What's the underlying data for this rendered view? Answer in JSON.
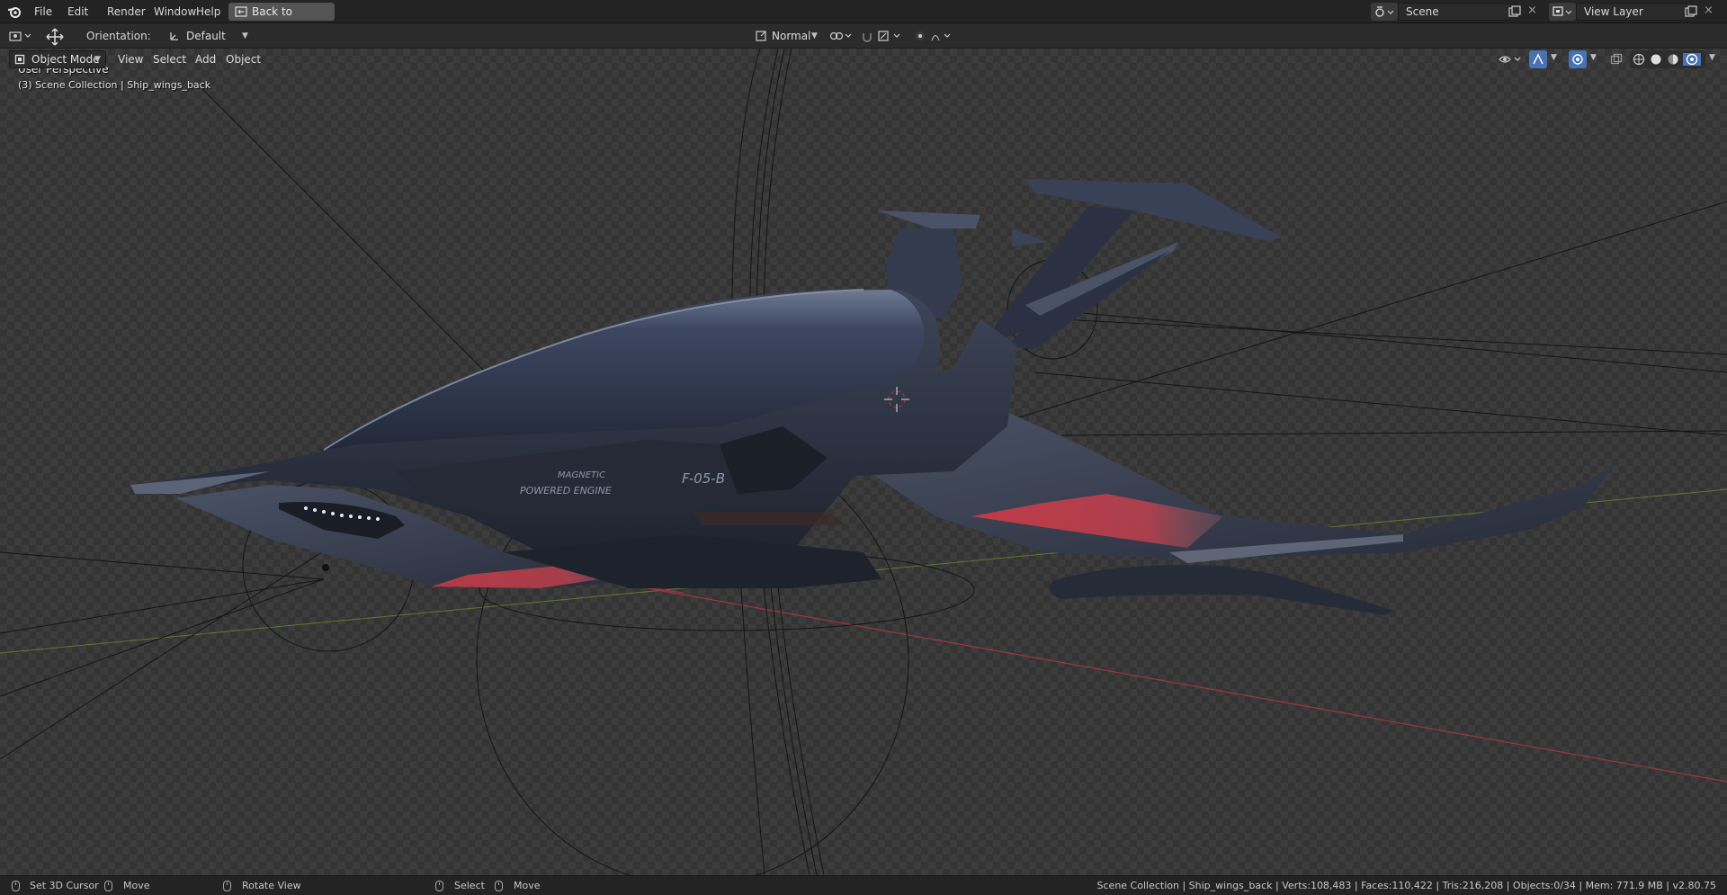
{
  "menu": {
    "items": [
      "File",
      "Edit",
      "Render",
      "Window",
      "Help"
    ],
    "back_button": "Back to Previous",
    "scene_name": "Scene",
    "view_layer_name": "View Layer"
  },
  "tool_settings": {
    "orientation_label": "Orientation:",
    "orientation_value": "Default",
    "pivot_value": "Normal"
  },
  "viewport_header": {
    "mode": "Object Mode",
    "menus": [
      "View",
      "Select",
      "Add",
      "Object"
    ]
  },
  "viewport": {
    "perspective": "User Perspective",
    "collection_info": "(3) Scene Collection | Ship_wings_back",
    "decals": [
      "MAGNETIC",
      "POWERED ENGINE",
      "F-05-B"
    ]
  },
  "status": {
    "set_cursor": "Set 3D Cursor",
    "move1": "Move",
    "rotate_view": "Rotate View",
    "select": "Select",
    "move2": "Move",
    "stats": "Scene Collection | Ship_wings_back | Verts:108,483 | Faces:110,422 | Tris:216,208 | Objects:0/34 | Mem: 771.9 MB | v2.80.75"
  },
  "colors": {
    "accent_blue": "#4772b3",
    "ship_body": "#2e3445",
    "ship_red": "#c83a46",
    "x_axis": "#a03540",
    "y_axis": "#6a8a2a"
  },
  "icons": [
    "blender-logo",
    "back-icon",
    "scene-icon",
    "view-layer-icon",
    "transform-icon",
    "snap-icon",
    "proportional-icon",
    "overlay-icon",
    "gizmo-icon",
    "shading-icons",
    "mouse-icon"
  ]
}
